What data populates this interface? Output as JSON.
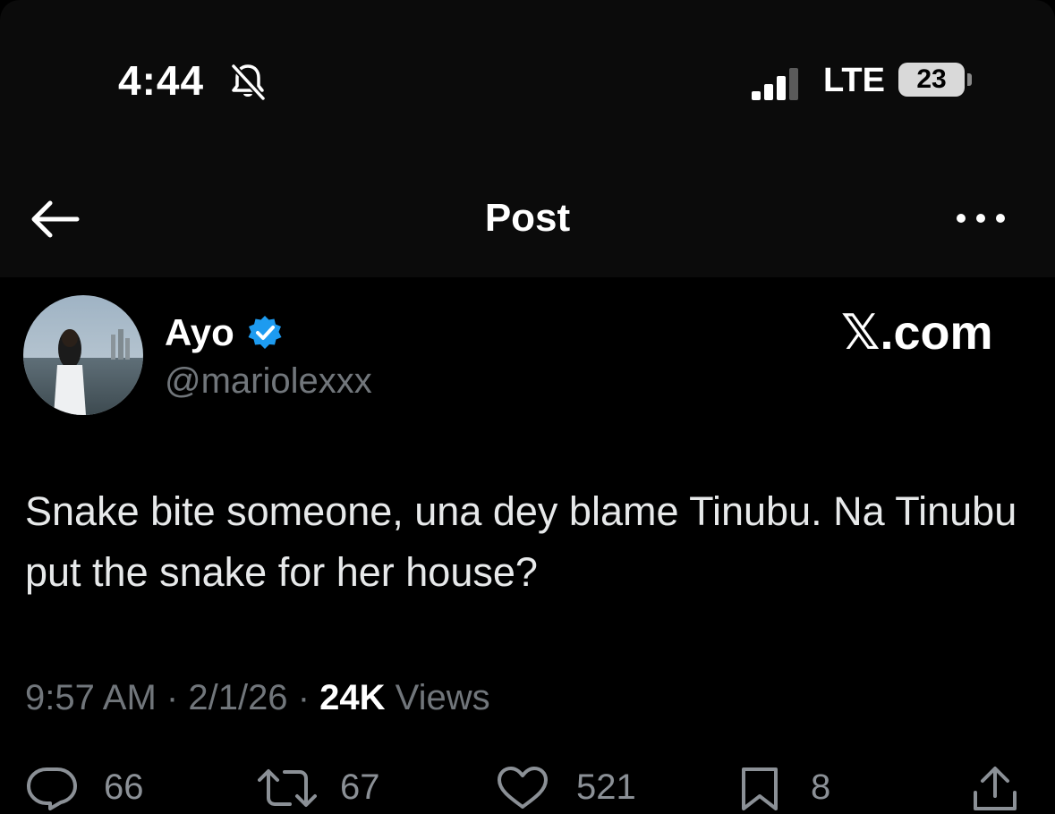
{
  "status_bar": {
    "time": "4:44",
    "network": "LTE",
    "battery": "23",
    "icons": [
      "bell-slash-icon",
      "signal-icon",
      "battery-icon"
    ]
  },
  "nav": {
    "title": "Post",
    "icons": [
      "back-arrow-icon",
      "more-icon"
    ]
  },
  "post": {
    "author_name": "Ayo",
    "author_handle": "@mariolexxx",
    "watermark": "𝕏.com",
    "text": "Snake bite someone, una dey blame Tinubu. Na Tinubu put the snake for her house?",
    "time": "9:57 AM",
    "date": "2/1/26",
    "views_count": "24K",
    "views_label": "Views",
    "separator": "·"
  },
  "actions": {
    "replies": "66",
    "reposts": "67",
    "likes": "521",
    "bookmarks": "8",
    "icons": [
      "reply-icon",
      "repost-icon",
      "like-icon",
      "bookmark-icon",
      "share-icon"
    ]
  },
  "colors": {
    "background": "#000000",
    "header": "#0b0b0b",
    "text": "#e7e9ea",
    "secondary": "#71767b",
    "verified": "#1d9bf0"
  }
}
